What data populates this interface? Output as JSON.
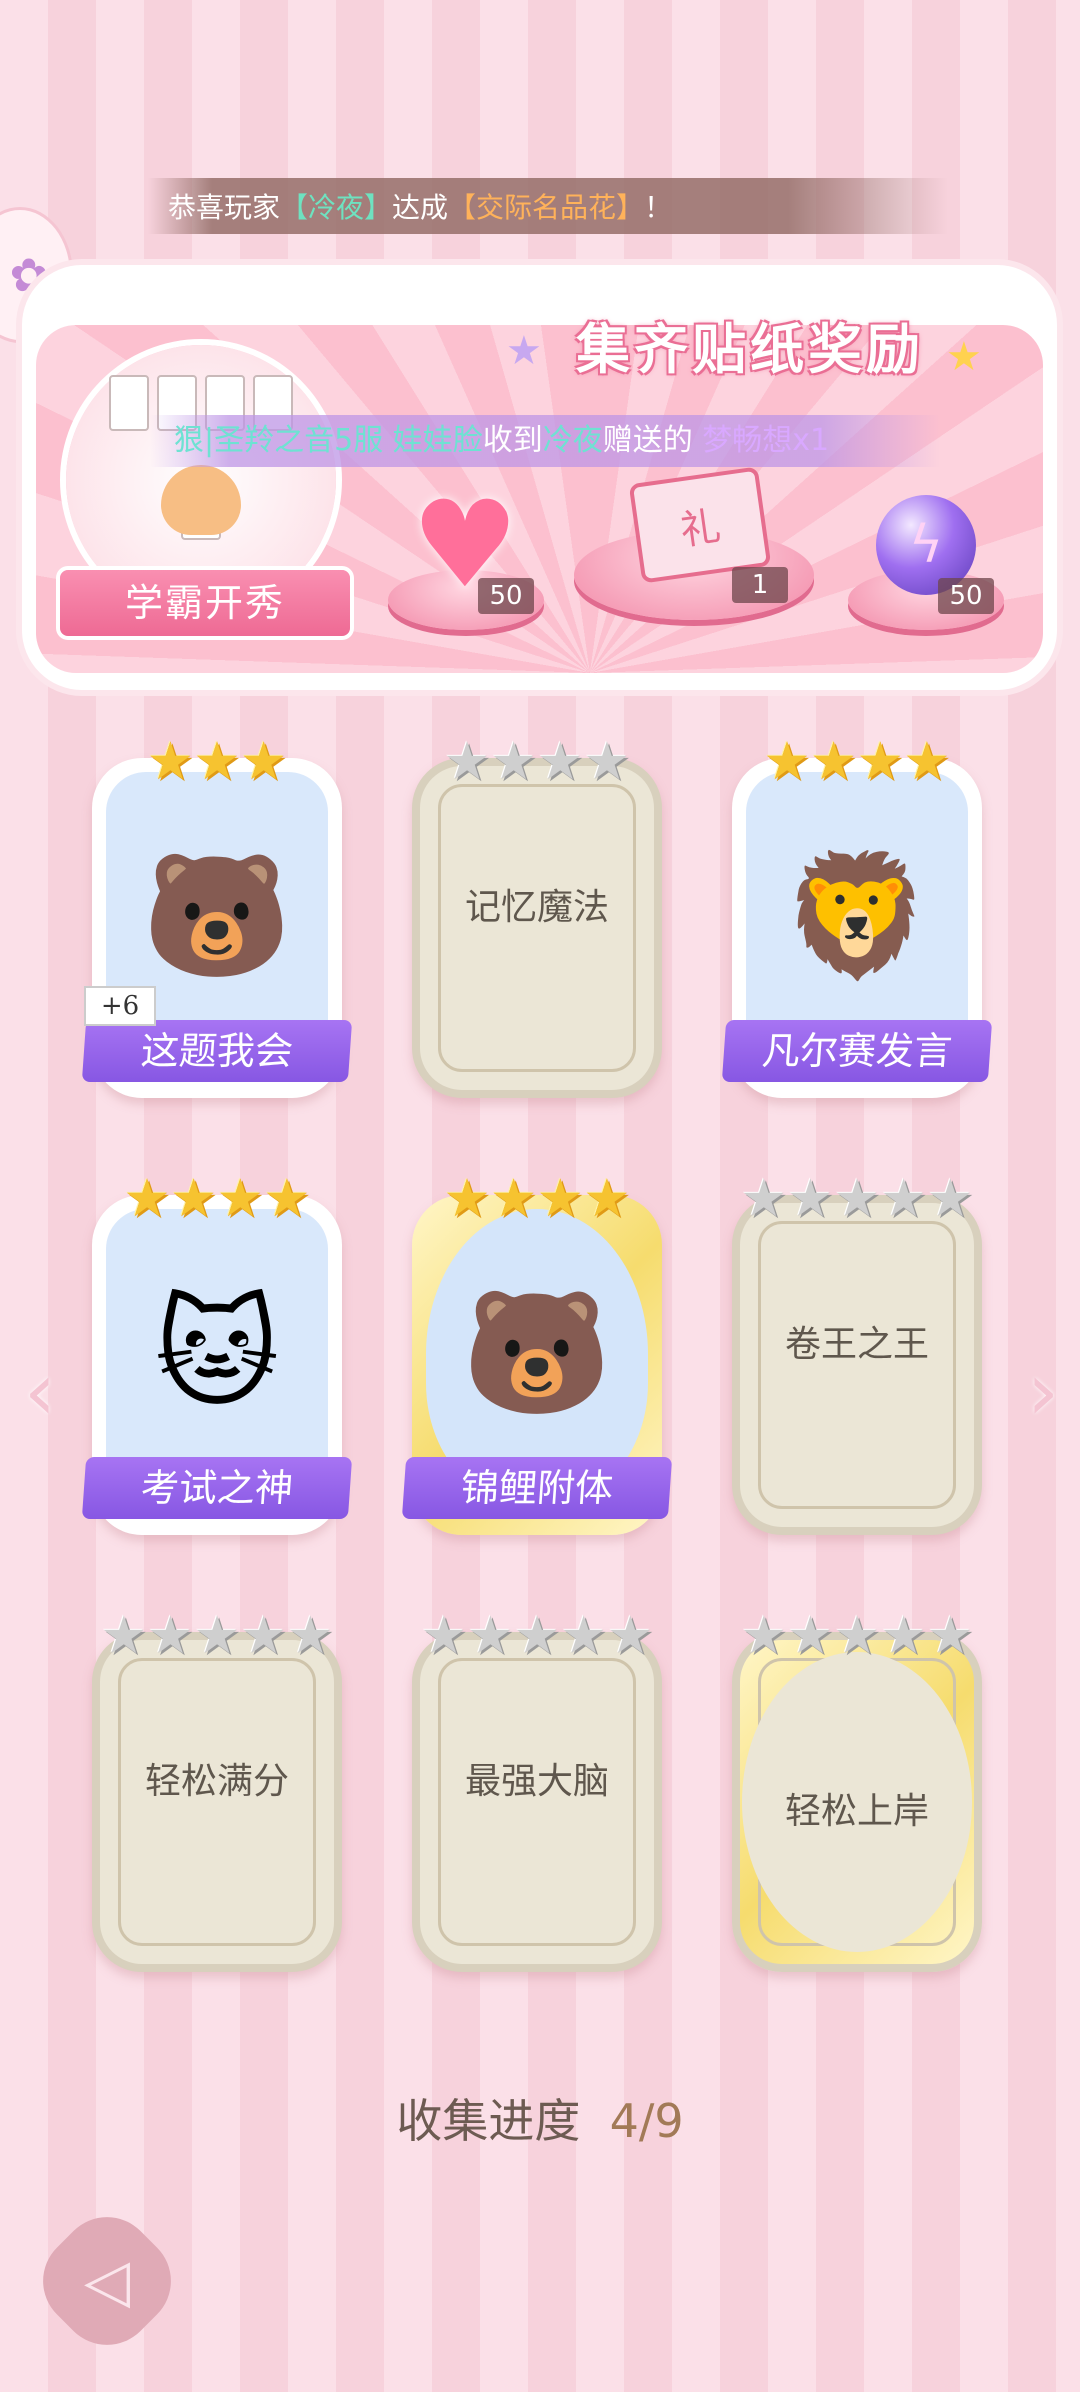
{
  "marquee": {
    "prefix": "恭喜玩家",
    "player": "【冷夜】",
    "middle": "达成",
    "achievement": "【交际名品花】",
    "suffix": "！"
  },
  "reward_panel": {
    "title": "集齐贴纸奖励",
    "sticker_name": "学霸开秀",
    "notice": {
      "sender_server": "狠|圣羚之音5服",
      "sender_name": "娃娃脸",
      "received": "收到",
      "giver": "冷夜",
      "sent": "赠送的",
      "item": "梦畅想x1"
    },
    "rewards": [
      {
        "icon": "heart-gem-icon",
        "count": "50"
      },
      {
        "icon": "gift-box-icon",
        "count": "1"
      },
      {
        "icon": "energy-orb-icon",
        "count": "50"
      }
    ]
  },
  "cards": [
    {
      "name": "这题我会",
      "stars": 3,
      "filled": 3,
      "unlocked": true,
      "gold": false,
      "art": "🐻",
      "badge": "+6"
    },
    {
      "name": "记忆魔法",
      "stars": 4,
      "filled": 0,
      "unlocked": false,
      "gold": false,
      "art": "",
      "badge": ""
    },
    {
      "name": "凡尔赛发言",
      "stars": 4,
      "filled": 4,
      "unlocked": true,
      "gold": false,
      "art": "🦁",
      "badge": ""
    },
    {
      "name": "考试之神",
      "stars": 4,
      "filled": 4,
      "unlocked": true,
      "gold": false,
      "art": "🐱",
      "badge": ""
    },
    {
      "name": "锦鲤附体",
      "stars": 4,
      "filled": 4,
      "unlocked": true,
      "gold": true,
      "art": "🐻",
      "badge": ""
    },
    {
      "name": "卷王之王",
      "stars": 5,
      "filled": 0,
      "unlocked": false,
      "gold": false,
      "art": "",
      "badge": ""
    },
    {
      "name": "轻松满分",
      "stars": 5,
      "filled": 0,
      "unlocked": false,
      "gold": false,
      "art": "",
      "badge": ""
    },
    {
      "name": "最强大脑",
      "stars": 5,
      "filled": 0,
      "unlocked": false,
      "gold": false,
      "art": "",
      "badge": ""
    },
    {
      "name": "轻松上岸",
      "stars": 5,
      "filled": 0,
      "unlocked": false,
      "gold": true,
      "art": "",
      "badge": ""
    }
  ],
  "progress": {
    "label": "收集进度",
    "value": "4/9",
    "fraction": 0.444
  },
  "nav": {
    "prev": "‹",
    "next": "›"
  },
  "colors": {
    "ribbon": "#8f5fe6",
    "accent_pink": "#ee6a94",
    "star_gold": "#f6c330",
    "star_gray": "#cfcfcf"
  }
}
